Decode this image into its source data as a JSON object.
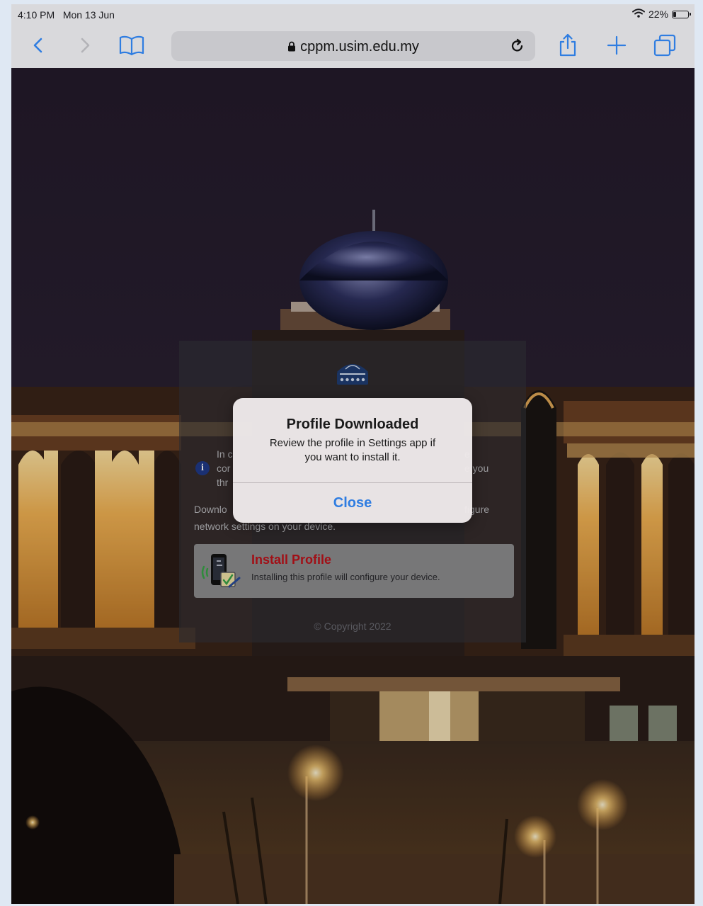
{
  "status_bar": {
    "time": "4:10 PM",
    "date": "Mon 13 Jun",
    "battery_percent": "22%",
    "battery_level": 0.22
  },
  "toolbar": {
    "url": "cppm.usim.edu.my"
  },
  "portal": {
    "info_fragments": [
      "In c",
      "cor",
      "thr",
      "e",
      "e you"
    ],
    "download_fragments": [
      "Downlo",
      "figure"
    ],
    "download_tail": "network settings on your device.",
    "install_title": "Install Profile",
    "install_desc": "Installing this profile will configure your device.",
    "copyright": "© Copyright 2022"
  },
  "alert": {
    "title": "Profile Downloaded",
    "message_line1": "Review the profile in Settings app if",
    "message_line2": "you want to install it.",
    "close_label": "Close"
  },
  "colors": {
    "link_blue": "#2f7de1",
    "install_red": "#c0121b",
    "toolbar_icon_blue": "#2f7de1"
  }
}
